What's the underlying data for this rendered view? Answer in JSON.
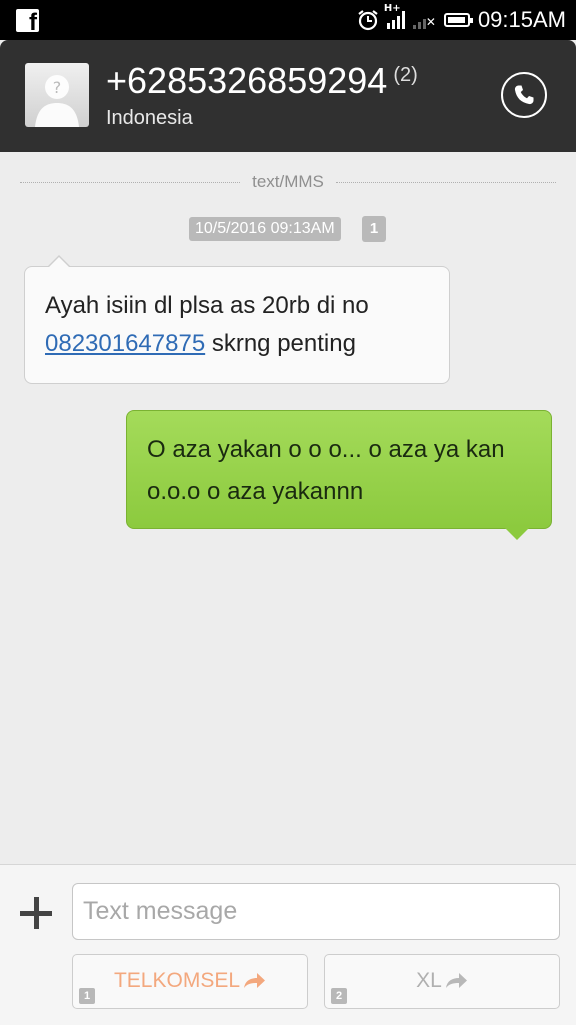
{
  "status_bar": {
    "app_icon": "facebook-icon",
    "network_type": "H+",
    "time": "09:15AM"
  },
  "header": {
    "contact_number": "+6285326859294",
    "message_count": "(2)",
    "country": "Indonesia",
    "avatar_icon": "default-avatar-icon",
    "call_icon": "phone-icon"
  },
  "conversation": {
    "type_label": "text/MMS",
    "timestamp": "10/5/2016 09:13AM",
    "sim_slot": "1",
    "incoming": {
      "text_before": "Ayah isiin dl plsa as 20rb di no",
      "phone_link": "082301647875",
      "text_after": " skrng penting"
    },
    "outgoing": {
      "text": "O aza yakan o o o... o aza ya kan o.o.o o aza yakannn"
    }
  },
  "composer": {
    "placeholder": "Text message",
    "send_buttons": [
      {
        "slot": "1",
        "label": "TELKOMSEL",
        "color": "#f3a87e"
      },
      {
        "slot": "2",
        "label": "XL",
        "color": "#b0b0b0"
      }
    ]
  }
}
